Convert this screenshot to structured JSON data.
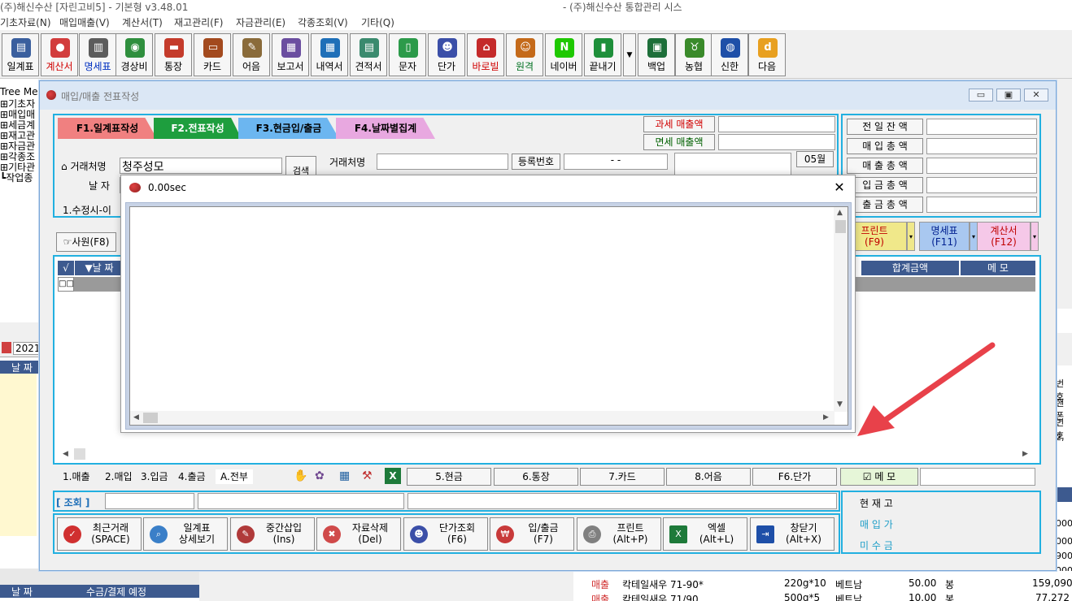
{
  "app": {
    "title_left": "(주)해신수산    [자린고비5] - 기본형 v3.48.01",
    "title_right": "- (주)해신수산 통합관리 시스"
  },
  "menu": [
    "기초자료(N)",
    "매입매출(V)",
    "계산서(T)",
    "재고관리(F)",
    "자금관리(E)",
    "각종조회(V)",
    "기타(Q)"
  ],
  "toolbar": [
    {
      "label": "일계표",
      "color": "#3a5f9e",
      "glyph": "▤"
    },
    {
      "label": "계산서",
      "color": "#d23c3c",
      "glyph": "●",
      "label_color": "#d00000"
    },
    {
      "label": "명세표",
      "color": "#5c5c5c",
      "glyph": "▥",
      "label_color": "#0030c0"
    },
    {
      "label": "경상비",
      "color": "#2f8f3e",
      "glyph": "◉"
    },
    {
      "label": "통장",
      "color": "#c43b2b",
      "glyph": "▬"
    },
    {
      "label": "카드",
      "color": "#a34a1e",
      "glyph": "▭"
    },
    {
      "label": "어음",
      "color": "#8a6b3a",
      "glyph": "✎"
    },
    {
      "label": "보고서",
      "color": "#6b4ea0",
      "glyph": "▦"
    },
    {
      "label": "내역서",
      "color": "#1e6fb8",
      "glyph": "▦"
    },
    {
      "label": "견적서",
      "color": "#3a8a6e",
      "glyph": "▤"
    },
    {
      "label": "문자",
      "color": "#2c9a4a",
      "glyph": "▯"
    },
    {
      "label": "단가",
      "color": "#3b4fa8",
      "glyph": "☻"
    },
    {
      "label": "바로빌",
      "color": "#c42a2a",
      "glyph": "⌂",
      "label_color": "#d00000"
    },
    {
      "label": "원격",
      "color": "#c46a1a",
      "glyph": "☺",
      "label_color": "#007020"
    },
    {
      "label": "네이버",
      "color": "#1ec800",
      "glyph": "N"
    },
    {
      "label": "끝내기",
      "color": "#1e8f3a",
      "glyph": "▮"
    },
    {
      "label": "백업",
      "color": "#1e6f3a",
      "glyph": "▣"
    },
    {
      "label": "농협",
      "color": "#3a8a2a",
      "glyph": "♉"
    },
    {
      "label": "신한",
      "color": "#1e4fa8",
      "glyph": "◍"
    },
    {
      "label": "다음",
      "color": "#e8a020",
      "glyph": "d"
    }
  ],
  "tree": {
    "header": "Tree Menu",
    "items": [
      "기초자",
      "매입매",
      "세금계",
      "재고관",
      "자금관",
      "각종조",
      "기타관",
      "작업종"
    ]
  },
  "form": {
    "title": "매입/매출 전표작성",
    "tabs": [
      "F1.일계표작성",
      "F2.전표작성",
      "F3.현금입/출금",
      "F4.날짜별집계"
    ],
    "tax_sales_label": "과세 매출액",
    "exempt_sales_label": "면세 매출액",
    "customer_label": "거래처명",
    "customer_value": "청주성모",
    "search_button": "검색",
    "date_label": "날 자",
    "customer2_label": "거래처명",
    "regno_label": "등록번호",
    "regno_value": "-   -",
    "month_value": "05월",
    "subtab": "1.수정시-이",
    "employee_button": "사원(F8)",
    "summary_labels": [
      "전 일 잔 액",
      "매 입 총 액",
      "매 출 총 액",
      "입 금 총 액",
      "출 금 총 액"
    ],
    "print_buttons": [
      {
        "label": "프린트\n(F9)",
        "color": "#f0e88a"
      },
      {
        "label": "명세표\n(F11)",
        "color": "#a9c8f0"
      },
      {
        "label": "계산서\n(F12)",
        "color": "#f5c8e8"
      }
    ],
    "grid_headers": [
      "√",
      "▼날 짜",
      "합계금액",
      "메 모"
    ],
    "bottom_tabs": [
      "1.매출",
      "2.매입",
      "3.입금",
      "4.출금",
      "A.전부"
    ],
    "quick_buttons": [
      "5.현금",
      "6.통장",
      "7.카드",
      "8.어음",
      "F6.단가"
    ],
    "memo_label": "메 모",
    "lookup_label": "[ 조회 ]",
    "stock_labels": [
      "현 재 고",
      "매 입 가",
      "미 수 금"
    ],
    "func_buttons": [
      {
        "label": "최근거래\n(SPACE)",
        "color": "#d03030",
        "glyph": "✓"
      },
      {
        "label": "일계표\n상세보기",
        "color": "#3a7fc8",
        "glyph": "⌕"
      },
      {
        "label": "중간삽입\n(Ins)",
        "color": "#b03a3a",
        "glyph": "✎"
      },
      {
        "label": "자료삭제\n(Del)",
        "color": "#d04a4a",
        "glyph": "✖"
      },
      {
        "label": "단가조회\n(F6)",
        "color": "#3b4fa8",
        "glyph": "☻"
      },
      {
        "label": "입/출금\n(F7)",
        "color": "#c83a3a",
        "glyph": "₩"
      },
      {
        "label": "프린트\n(Alt+P)",
        "color": "#808080",
        "glyph": "⎙"
      },
      {
        "label": "엑셀\n(Alt+L)",
        "color": "#1e7a3a",
        "glyph": "X"
      },
      {
        "label": "창닫기\n(Alt+X)",
        "color": "#1e4fa8",
        "glyph": "⇥"
      }
    ]
  },
  "popup": {
    "title": "0.00sec",
    "close": "✕"
  },
  "background": {
    "left_date": "2021.",
    "left_col": "날 짜",
    "left_bottom_cols": [
      "날 짜",
      "수금/결제 예정"
    ],
    "right_snippets": [
      "번호",
      "핸폰",
      "번호",
      "2,",
      "000",
      "000",
      "900",
      "000"
    ],
    "rows": [
      {
        "type": "매출",
        "item": "칵테일새우 71-90*",
        "spec": "220g*10",
        "origin": "베트남",
        "qty": "50.00",
        "unit": "봉",
        "amount": "159,090"
      },
      {
        "type": "매출",
        "item": "칵테일새우 71/90",
        "spec": "500g*5",
        "origin": "베트남",
        "qty": "10.00",
        "unit": "봉",
        "amount": "77,272"
      }
    ]
  },
  "colors": {
    "accent": "#22b0e0",
    "arrow": "#e8414a",
    "grid_header": "#3d5a8f"
  }
}
